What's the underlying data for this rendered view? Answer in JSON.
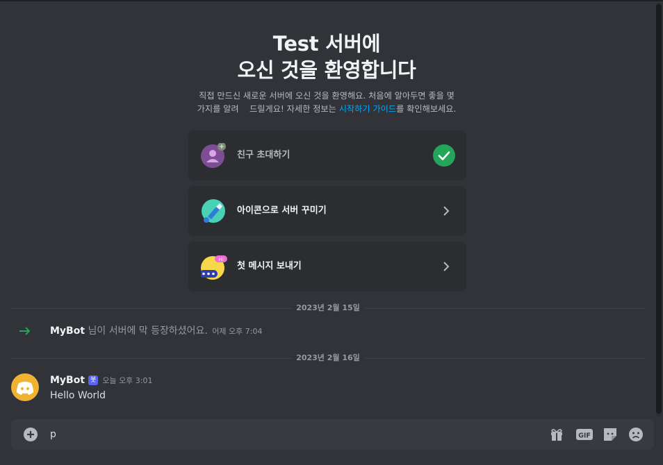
{
  "welcome": {
    "title_line1": "Test 서버에",
    "title_line2": "오신 것을 환영합니다",
    "desc_line1": "직접 만드신 새로운 서버에 오신 것을 환영해요. 처음에 알아두면 좋을 몇",
    "desc_line2_pre": "가지를 알려    드릴게요! 자세한 정보는 ",
    "desc_link": "시작하기 가이드",
    "desc_line2_post": "를 확인해보세요."
  },
  "cards": [
    {
      "label": "친구 초대하기",
      "status": "completed",
      "icon": "invite-friend-icon"
    },
    {
      "label": "아이콘으로 서버 꾸미기",
      "status": "todo",
      "icon": "customize-server-icon"
    },
    {
      "label": "첫 메시지 보내기",
      "status": "todo",
      "icon": "first-message-icon"
    }
  ],
  "dividers": [
    "2023년 2월 15일",
    "2023년 2월 16일"
  ],
  "join_message": {
    "username": "MyBot",
    "text": " 님이 서버에 막 등장하셨어요. ",
    "timestamp": "어제 오후 7:04"
  },
  "message": {
    "author": "MyBot",
    "badge": "봇",
    "timestamp": "오늘 오후 3:01",
    "content": "Hello World"
  },
  "composer": {
    "value": "p",
    "gif_label": "GIF"
  },
  "colors": {
    "background": "#313338",
    "card": "#2b2d31",
    "accent_link": "#00a8fc",
    "success": "#23a55a",
    "blurple": "#5865f2"
  }
}
